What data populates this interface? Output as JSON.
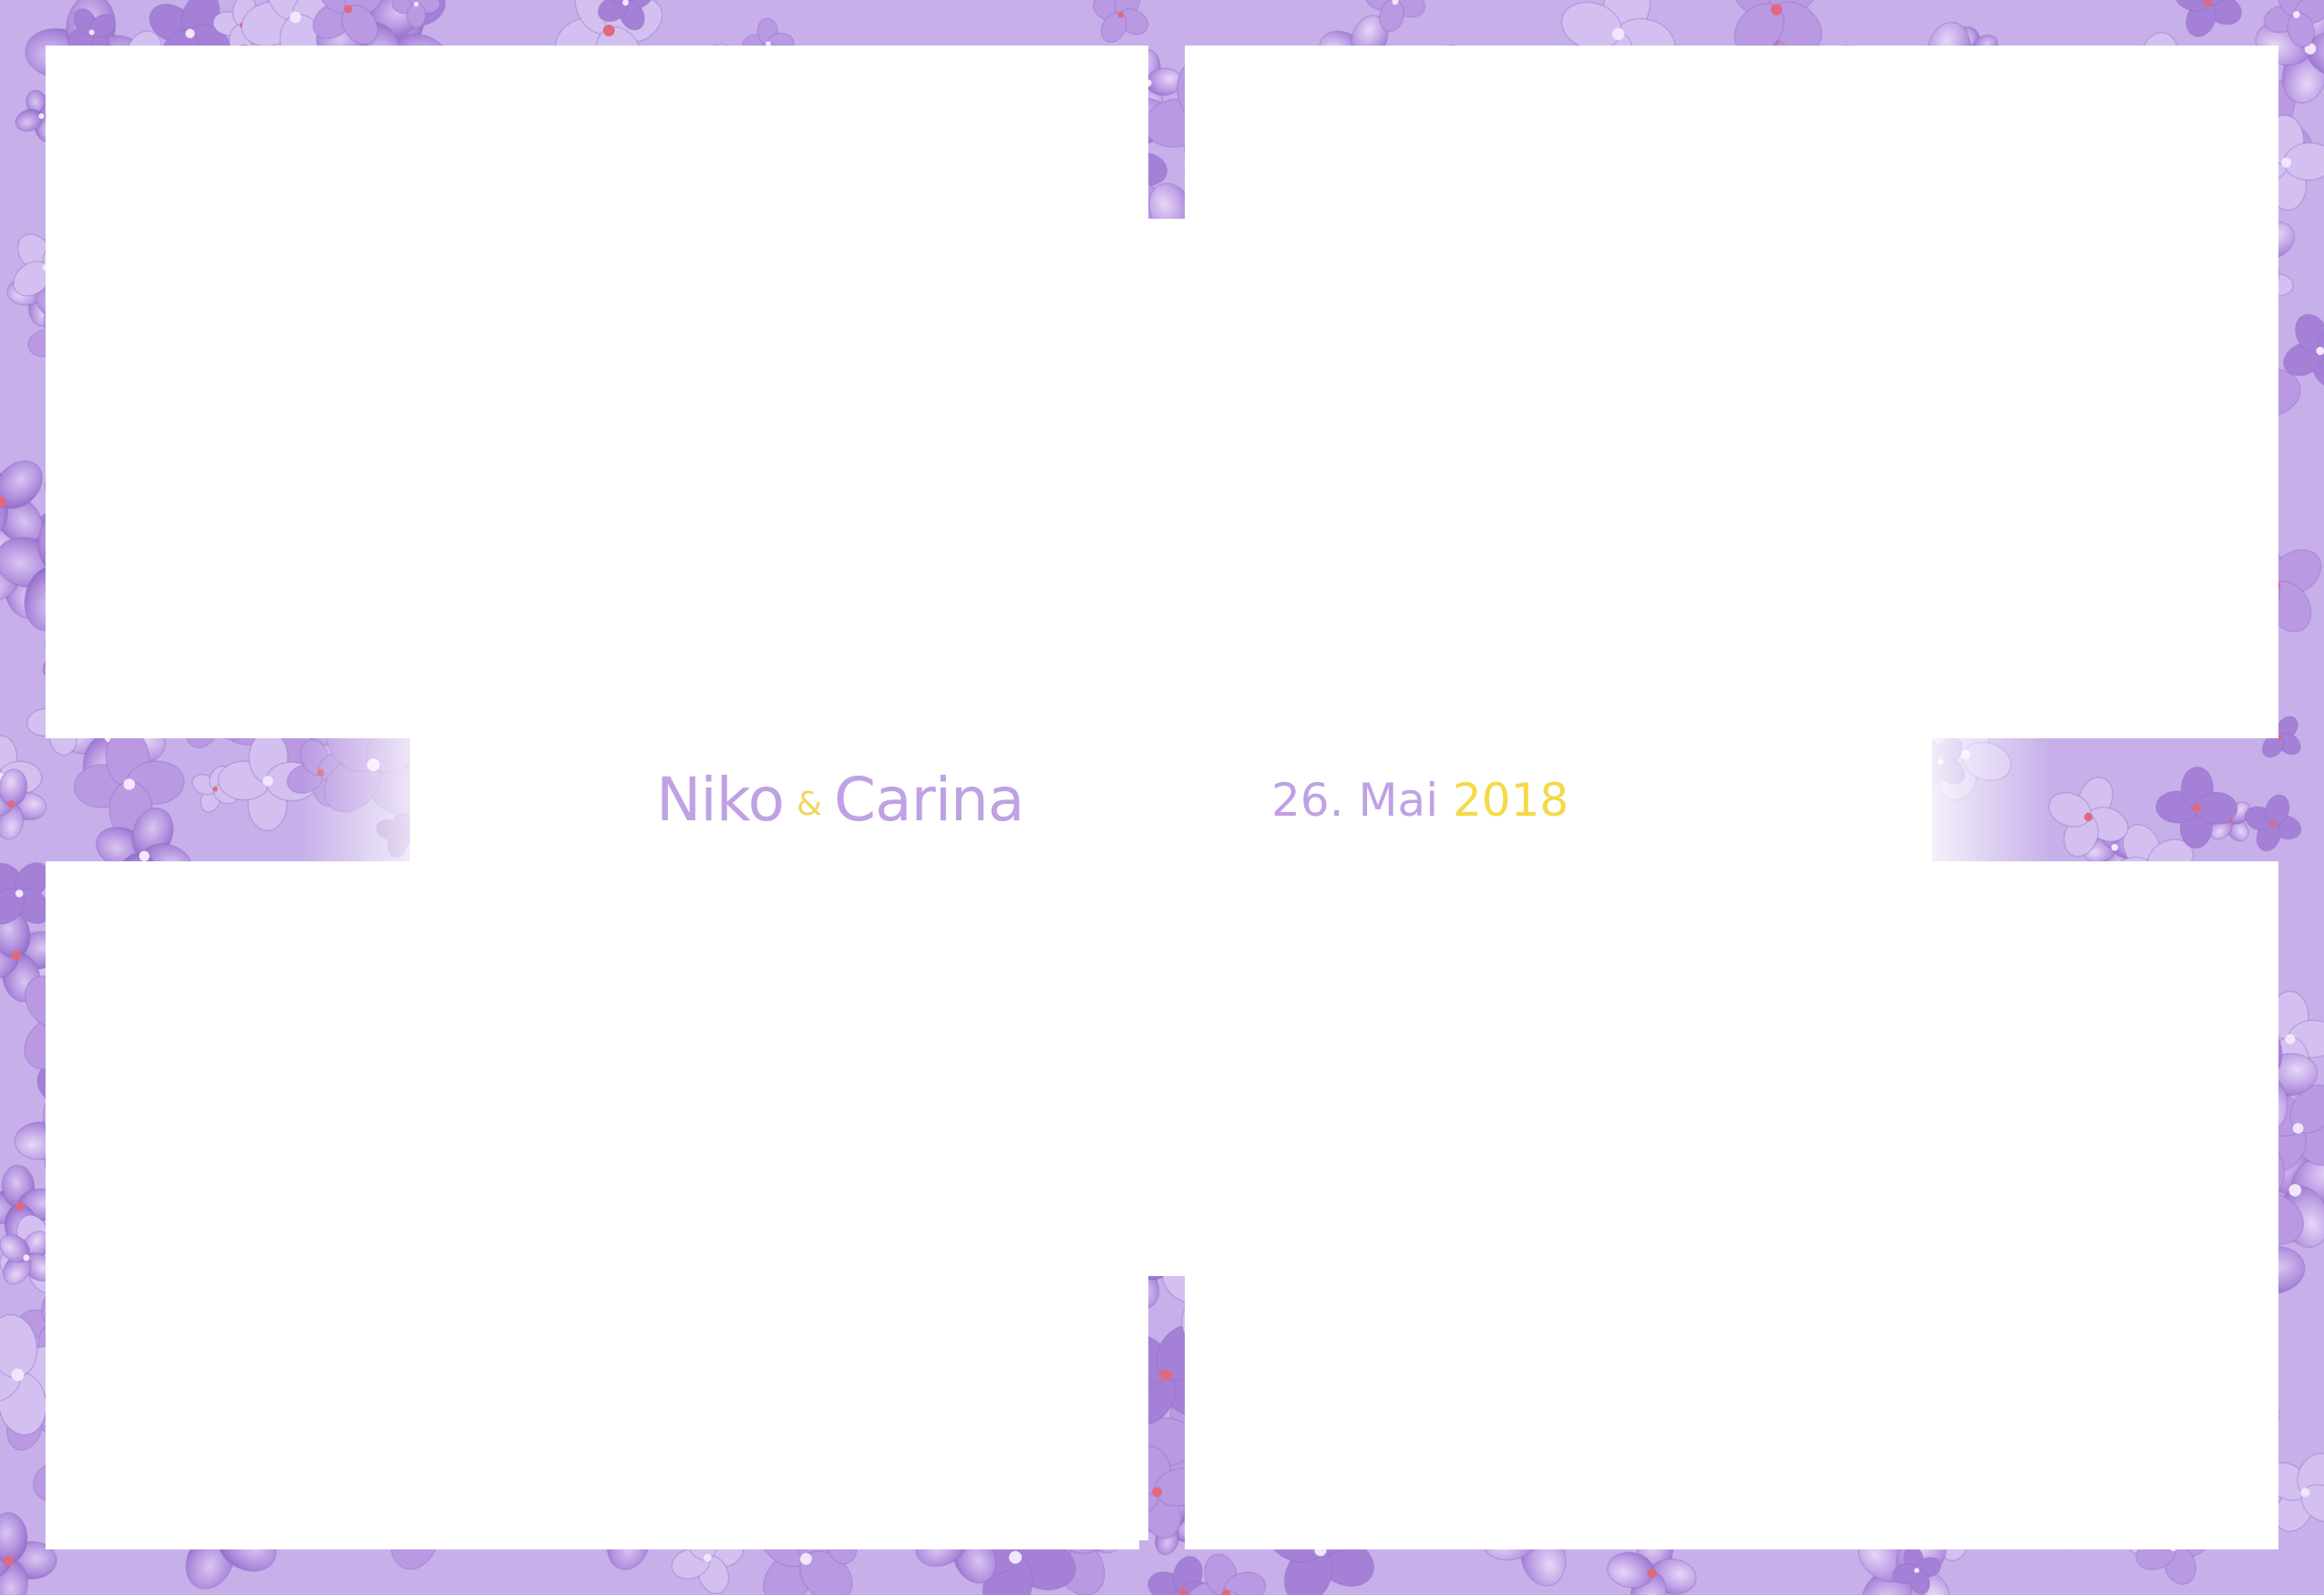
{
  "card": {
    "name_1": "Niko",
    "ampersand": "&",
    "name_2": "Carina",
    "date_day_month": "26. Mai",
    "date_year": "2018"
  },
  "colors": {
    "name_text": "#bfa1e4",
    "ampersand": "#f0d65c",
    "year_text": "#f5d946",
    "flower_light": "#cdb4ee",
    "flower_mid": "#a987d8",
    "flower_dark": "#8b65c4",
    "photo_slot": "#ffffff"
  },
  "photo_slots": [
    "top-left",
    "top-right",
    "bottom-left",
    "bottom-right"
  ]
}
